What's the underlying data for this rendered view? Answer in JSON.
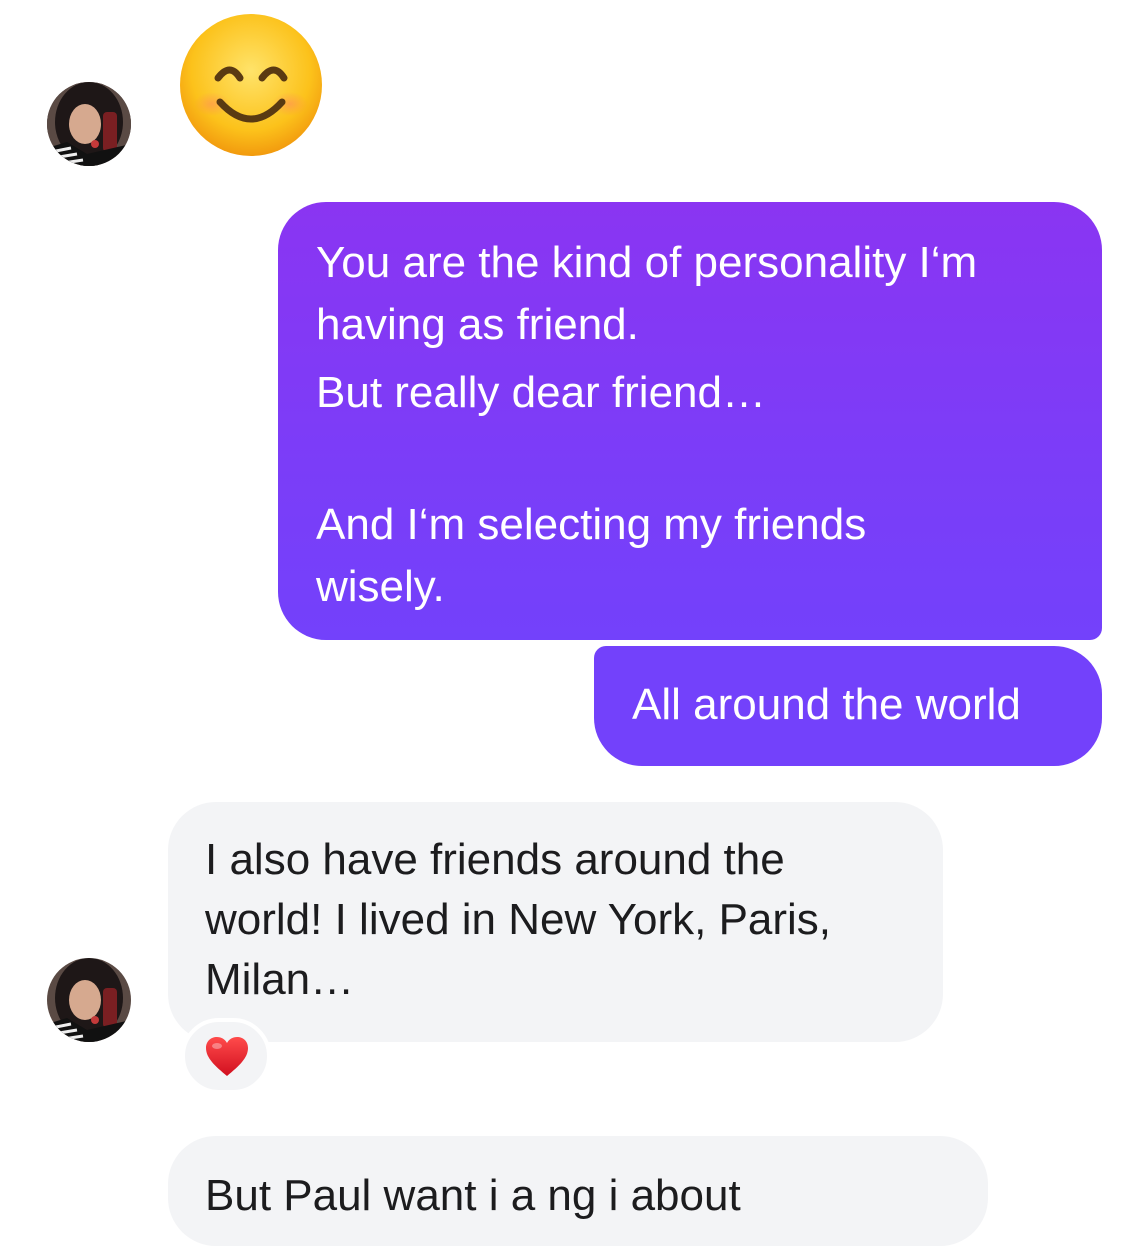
{
  "conversation": {
    "messages": [
      {
        "sender": "contact",
        "type": "emoji",
        "emoji_icon": "smiling-face-icon"
      },
      {
        "sender": "me",
        "type": "text",
        "lines": [
          "You are the kind of personality I‘m",
          "having as friend.",
          "But really dear friend…",
          "",
          "And I‘m selecting my friends",
          "wisely."
        ]
      },
      {
        "sender": "me",
        "type": "text",
        "text": "All around the world"
      },
      {
        "sender": "contact",
        "type": "text",
        "lines": [
          "I also have friends around the",
          "world! I lived in New York, Paris,",
          "Milan…"
        ],
        "reaction_icon": "red-heart-icon"
      },
      {
        "sender": "contact",
        "type": "text",
        "text": "But Paul  want    i    a  ng  i    about"
      }
    ]
  },
  "colors": {
    "outgoing_top": "#8a35f2",
    "outgoing_bottom": "#7341fb",
    "incoming_bg": "#f3f4f6",
    "background": "#ffffff"
  }
}
